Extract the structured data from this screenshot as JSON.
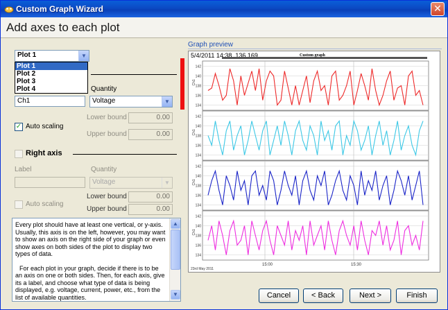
{
  "window": {
    "title": "Custom Graph Wizard",
    "close_glyph": "✕"
  },
  "header": {
    "title": "Add axes to each plot"
  },
  "plot_select": {
    "value": "Plot 1",
    "options": [
      "Plot 1",
      "Plot 2",
      "Plot 3",
      "Plot 4"
    ]
  },
  "left_axis": {
    "quantity_label": "Quantity",
    "label_value": "Ch1",
    "quantity_value": "Voltage",
    "lower_bound_label": "Lower bound",
    "lower_bound_value": "0.00",
    "upper_bound_label": "Upper bound",
    "upper_bound_value": "0.00",
    "auto_scaling_label": "Auto scaling",
    "auto_scaling_checked": true
  },
  "right_axis": {
    "title": "Right axis",
    "label_label": "Label",
    "label_value": "",
    "quantity_label": "Quantity",
    "quantity_value": "Voltage",
    "lower_bound_label": "Lower bound",
    "lower_bound_value": "0.00",
    "upper_bound_label": "Upper bound",
    "upper_bound_value": "0.00",
    "auto_scaling_label": "Auto scaling"
  },
  "help_text": {
    "para1": "Every plot should have at least one vertical, or y-axis. Usually, this axis is on the left, however, you may want to show an axis on the right side of your graph or even show axes on both sides of the plot to display two types of data.",
    "para2": "For each plot in your graph, decide if there is to be an axis on one or both sides.  Then, for each axis, give its a label, and choose what type of data is being displayed, e.g. voltage, current, power, etc., from the list of available quantities."
  },
  "preview": {
    "label": "Graph preview",
    "cursor_readout": "5/4/2011 14:38, 136.169",
    "graph_title": "Custom graph",
    "x_date_label": "23rd May 2011",
    "x_tick_labels": [
      "15:00",
      "15:30"
    ],
    "y_tick_labels": [
      "142",
      "140",
      "138",
      "136",
      "134"
    ],
    "channel_label": "Ch1"
  },
  "buttons": {
    "cancel": "Cancel",
    "back": "< Back",
    "next": "Next >",
    "finish": "Finish"
  },
  "colors": {
    "titlebar": "#0a4ac4",
    "series_1": "#ee2a2a",
    "series_2": "#3cc8e6",
    "series_3": "#1a24c8",
    "series_4": "#ee2ee0",
    "marker": "#ee1111"
  },
  "chart_data": {
    "type": "line",
    "x_ticks": [
      "15:00",
      "15:30"
    ],
    "y_ticks": [
      142,
      140,
      138,
      136,
      134
    ],
    "ylim": [
      133.5,
      142.5
    ],
    "series": [
      {
        "values": [
          137,
          137.5,
          140.5,
          138,
          135,
          136,
          141.5,
          139,
          134,
          140,
          136,
          138.5,
          141,
          137,
          141.5,
          135,
          139,
          141,
          140,
          134,
          135,
          141,
          137.5,
          134,
          138,
          134,
          137,
          140,
          134.5,
          139,
          141,
          137,
          138,
          134,
          140,
          141,
          135,
          136,
          138,
          141,
          134,
          137,
          140.5,
          138,
          135,
          141.5,
          137,
          134,
          136,
          139,
          141,
          135,
          137.5,
          138,
          134,
          140,
          141,
          136,
          137,
          134
        ]
      },
      {
        "values": [
          138,
          136,
          141,
          137,
          134,
          139,
          141,
          135,
          138,
          140,
          134,
          137,
          141,
          138,
          135,
          139,
          141,
          134,
          137,
          140,
          136,
          141,
          138,
          134,
          139,
          141,
          137,
          135,
          140,
          138,
          134,
          141,
          137,
          139,
          135,
          140,
          141,
          134,
          138,
          136,
          141,
          139,
          135,
          137,
          140,
          134,
          138,
          141,
          136,
          139,
          134,
          137,
          141,
          135,
          138,
          140,
          136,
          134,
          139,
          141
        ]
      },
      {
        "values": [
          136,
          139,
          141,
          137,
          134,
          140,
          138,
          135,
          141,
          137,
          139,
          134,
          140,
          141,
          136,
          138,
          135,
          141,
          139,
          134,
          137,
          141,
          138,
          136,
          140,
          134,
          139,
          141,
          137,
          135,
          140,
          138,
          141,
          134,
          136,
          139,
          141,
          137,
          135,
          140,
          138,
          134,
          141,
          136,
          139,
          137,
          141,
          135,
          138,
          140,
          134,
          137,
          141,
          139,
          136,
          140,
          135,
          138,
          141,
          134
        ]
      },
      {
        "values": [
          137,
          140,
          135,
          141,
          138,
          134,
          139,
          141,
          136,
          137,
          140,
          134,
          141,
          138,
          135,
          139,
          141,
          137,
          134,
          140,
          138,
          136,
          141,
          135,
          139,
          137,
          140,
          134,
          141,
          136,
          138,
          140,
          135,
          141,
          137,
          134,
          139,
          141,
          138,
          136,
          140,
          135,
          141,
          137,
          134,
          139,
          138,
          141,
          136,
          140,
          135,
          137,
          141,
          134,
          139,
          140,
          136,
          138,
          135,
          141
        ]
      }
    ]
  }
}
